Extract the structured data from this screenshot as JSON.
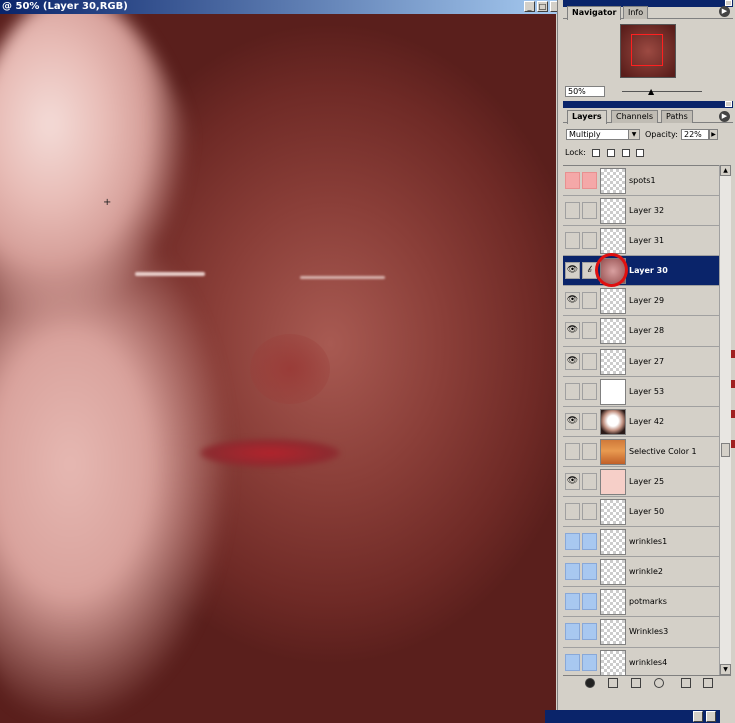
{
  "document": {
    "title": "@ 50% (Layer 30,RGB)"
  },
  "window_buttons": {
    "minimize": "_",
    "restore": "□",
    "close": "×"
  },
  "navigator": {
    "tabs": [
      "Navigator",
      "Info"
    ],
    "zoom": "50%"
  },
  "layers_palette": {
    "tabs": [
      "Layers",
      "Channels",
      "Paths"
    ],
    "blend_mode": "Multiply",
    "opacity_label": "Opacity:",
    "opacity": "22%",
    "lock_label": "Lock:",
    "layers": [
      {
        "name": "spots1",
        "visible": false,
        "style": "pink",
        "thumb": "checker"
      },
      {
        "name": "Layer 32",
        "visible": false,
        "style": "normal",
        "thumb": "checker"
      },
      {
        "name": "Layer 31",
        "visible": false,
        "style": "normal",
        "thumb": "checker"
      },
      {
        "name": "Layer 30",
        "visible": true,
        "style": "selected",
        "thumb": "sel",
        "link": "brush-icon"
      },
      {
        "name": "Layer 29",
        "visible": true,
        "style": "normal",
        "thumb": "checker"
      },
      {
        "name": "Layer 28",
        "visible": true,
        "style": "normal",
        "thumb": "checker"
      },
      {
        "name": "Layer 27",
        "visible": true,
        "style": "normal",
        "thumb": "checker"
      },
      {
        "name": "Layer 53",
        "visible": false,
        "style": "normal",
        "thumb": "white"
      },
      {
        "name": "Layer 42",
        "visible": true,
        "style": "normal",
        "thumb": "face"
      },
      {
        "name": "Selective Color 1",
        "visible": false,
        "style": "normal",
        "thumb": "orange"
      },
      {
        "name": "Layer 25",
        "visible": true,
        "style": "normal",
        "thumb": "pinkish"
      },
      {
        "name": "Layer 50",
        "visible": false,
        "style": "normal",
        "thumb": "checker"
      },
      {
        "name": "wrinkles1",
        "visible": false,
        "style": "blue",
        "thumb": "checker"
      },
      {
        "name": "wrinkle2",
        "visible": false,
        "style": "blue",
        "thumb": "checker"
      },
      {
        "name": "potmarks",
        "visible": false,
        "style": "blue",
        "thumb": "checker"
      },
      {
        "name": "Wrinkles3",
        "visible": false,
        "style": "blue",
        "thumb": "checker"
      },
      {
        "name": "wrinkles4",
        "visible": false,
        "style": "blue",
        "thumb": "checker"
      }
    ]
  },
  "icons": {
    "eye": "👁",
    "brush": "𝒷",
    "scroll_up": "▲",
    "scroll_down": "▼",
    "dropdown": "▼",
    "arrow_right": "▶",
    "cursor": "+"
  }
}
